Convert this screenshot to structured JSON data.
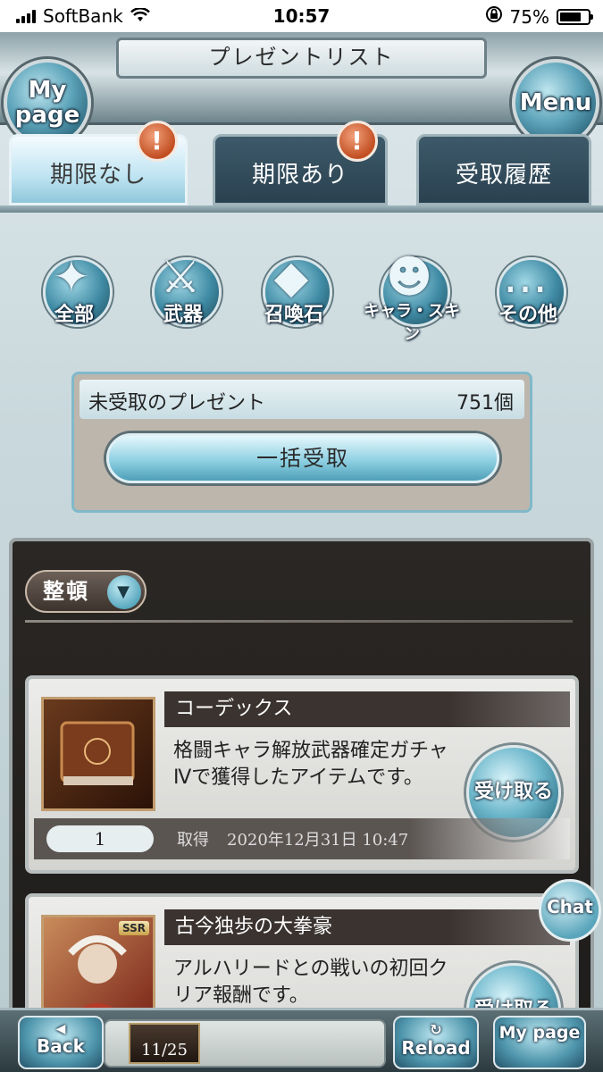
{
  "status_bar": {
    "carrier": "SoftBank",
    "time": "10:57",
    "battery": "75%"
  },
  "header": {
    "title": "プレゼントリスト",
    "left_button": "My page",
    "right_button": "Menu"
  },
  "tabs": [
    {
      "label": "期限なし",
      "active": true,
      "alert": "!"
    },
    {
      "label": "期限あり",
      "active": false,
      "alert": "!"
    },
    {
      "label": "受取履歴",
      "active": false
    }
  ],
  "filters": [
    {
      "label": "全部",
      "icon": "all-icon"
    },
    {
      "label": "武器",
      "icon": "sword-icon"
    },
    {
      "label": "召喚石",
      "icon": "crystal-icon"
    },
    {
      "label": "キャラ・スキン",
      "icon": "character-icon"
    },
    {
      "label": "その他",
      "icon": "more-icon"
    }
  ],
  "unclaimed": {
    "label": "未受取のプレゼント",
    "count": "751個",
    "bulk_button": "一括受取"
  },
  "sort": {
    "label": "整頓"
  },
  "items": [
    {
      "name": "コーデックス",
      "description": "格闘キャラ解放武器確定ガチャⅣで獲得したアイテムです。",
      "quantity": "1",
      "obtain_label": "取得",
      "date": "2020年12月31日 10:47",
      "take_button": "受け取る"
    },
    {
      "name": "古今独歩の大拳豪",
      "description": "アルハリードとの戦いの初回クリア報酬です。",
      "badge": "SSR",
      "take_button": "受け取る"
    }
  ],
  "chat_button": "Chat",
  "bottom_bar": {
    "back": "Back",
    "reload": "Reload",
    "mypage": "My page",
    "ap": "11/25"
  }
}
